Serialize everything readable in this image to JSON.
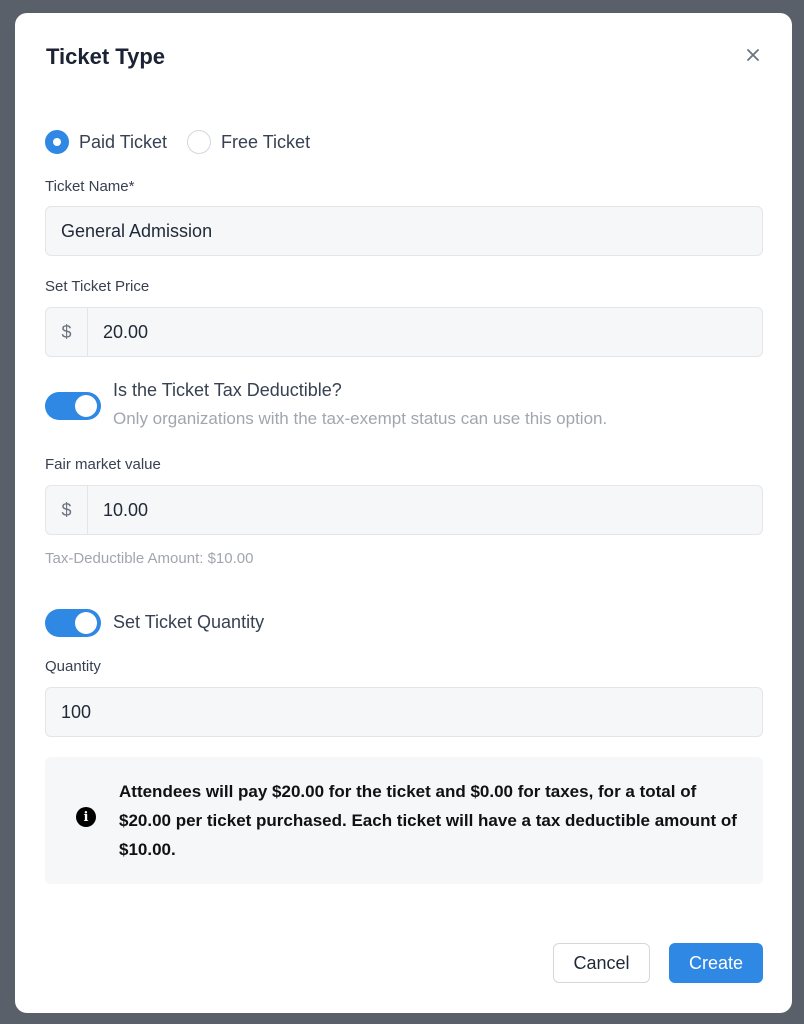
{
  "modal": {
    "title": "Ticket Type",
    "close_icon": "close-icon"
  },
  "ticket_kind": {
    "options": [
      {
        "label": "Paid Ticket",
        "selected": true
      },
      {
        "label": "Free Ticket",
        "selected": false
      }
    ]
  },
  "ticket_name": {
    "label": "Ticket Name*",
    "value": "General Admission"
  },
  "ticket_price": {
    "label": "Set Ticket Price",
    "prefix": "$",
    "value": "20.00"
  },
  "tax_deductible": {
    "enabled": true,
    "title": "Is the Ticket Tax Deductible?",
    "description": "Only organizations with the tax-exempt status can use this option."
  },
  "fair_market_value": {
    "label": "Fair market value",
    "prefix": "$",
    "value": "10.00",
    "hint": "Tax-Deductible Amount: $10.00"
  },
  "ticket_quantity_toggle": {
    "enabled": true,
    "title": "Set Ticket Quantity"
  },
  "quantity": {
    "label": "Quantity",
    "value": "100"
  },
  "summary": {
    "icon": "info-icon",
    "text": "Attendees will pay $20.00 for the ticket and $0.00 for taxes, for a total of $20.00 per ticket purchased. Each ticket will have a tax deductible amount of $10.00."
  },
  "actions": {
    "cancel_label": "Cancel",
    "create_label": "Create"
  },
  "colors": {
    "accent": "#2f88e3",
    "backdrop": "#596069"
  }
}
